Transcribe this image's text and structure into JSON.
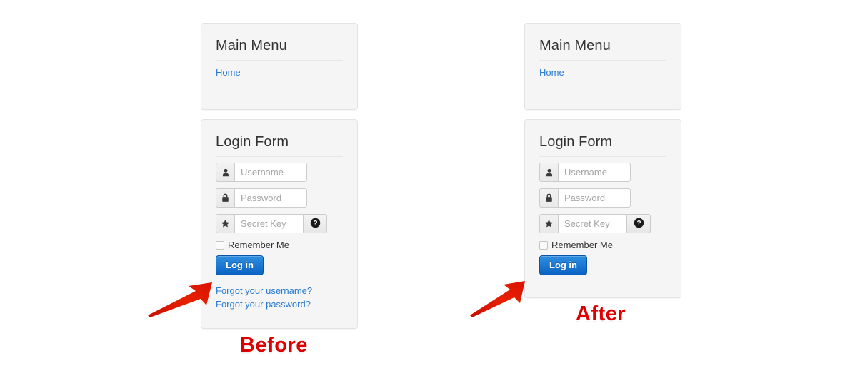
{
  "annotations": {
    "before_label": "Before",
    "after_label": "After",
    "arrow_color": "#e01b00"
  },
  "theme": {
    "link_color": "#2a7bd4",
    "panel_bg": "#f5f5f5",
    "panel_border": "#e3e3e3",
    "button_primary": "#0b62c4",
    "annotation_red": "#dd0000"
  },
  "before": {
    "menu_module": {
      "title": "Main Menu",
      "items": [
        {
          "label": "Home"
        }
      ]
    },
    "login_module": {
      "title": "Login Form",
      "username": {
        "placeholder": "Username",
        "value": "",
        "icon": "user-icon"
      },
      "password": {
        "placeholder": "Password",
        "value": "",
        "icon": "lock-icon"
      },
      "secret_key": {
        "placeholder": "Secret Key",
        "value": "",
        "icon": "star-icon",
        "help_icon": "question-circle-icon"
      },
      "remember_label": "Remember Me",
      "remember_checked": false,
      "submit_label": "Log in",
      "links": [
        {
          "label": "Forgot your username?"
        },
        {
          "label": "Forgot your password?"
        }
      ]
    }
  },
  "after": {
    "menu_module": {
      "title": "Main Menu",
      "items": [
        {
          "label": "Home"
        }
      ]
    },
    "login_module": {
      "title": "Login Form",
      "username": {
        "placeholder": "Username",
        "value": "",
        "icon": "user-icon"
      },
      "password": {
        "placeholder": "Password",
        "value": "",
        "icon": "lock-icon"
      },
      "secret_key": {
        "placeholder": "Secret Key",
        "value": "",
        "icon": "star-icon",
        "help_icon": "question-circle-icon"
      },
      "remember_label": "Remember Me",
      "remember_checked": false,
      "submit_label": "Log in",
      "links": []
    }
  }
}
